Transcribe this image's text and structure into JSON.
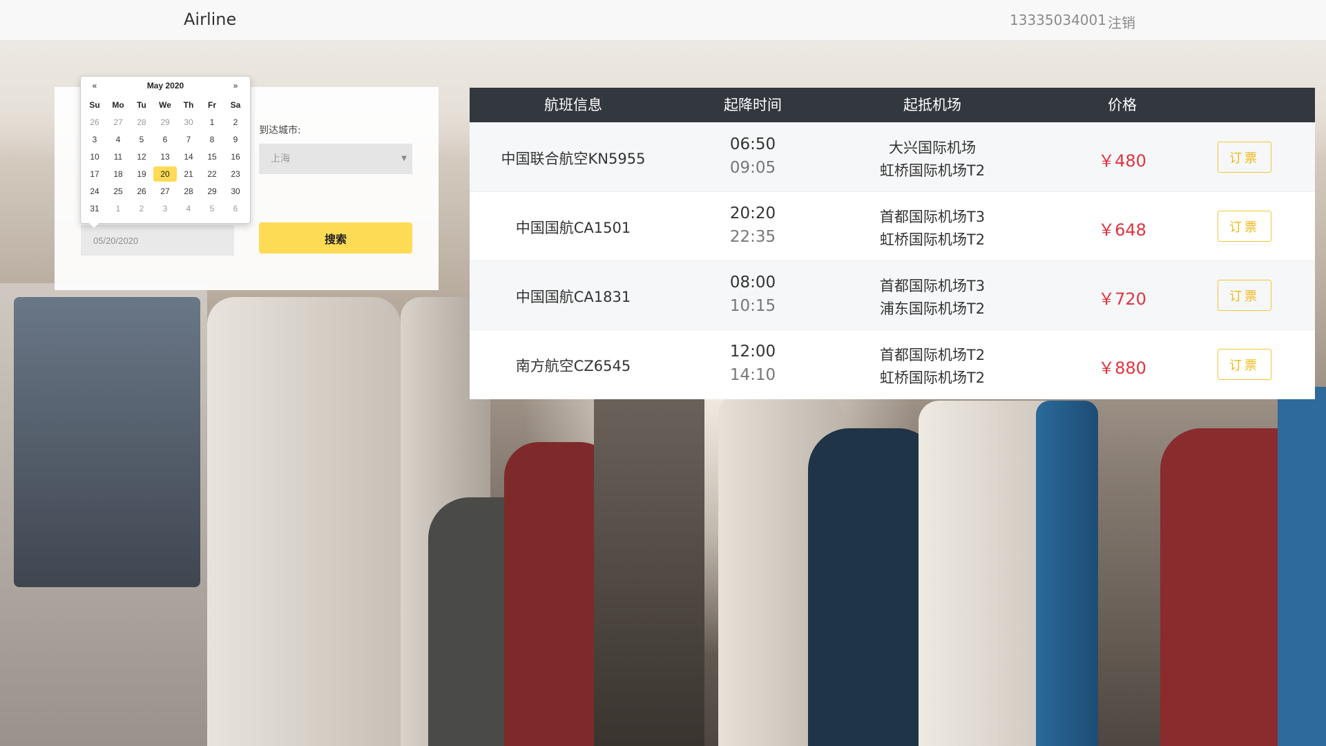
{
  "header": {
    "brand": "Airline",
    "user_phone": "13335034001",
    "logout": "注销"
  },
  "search": {
    "date_value": "05/20/2020",
    "arrive_label": "到达城市:",
    "arrive_value": "上海",
    "search_label": "搜索"
  },
  "datepicker": {
    "prev": "«",
    "next": "»",
    "title": "May 2020",
    "weekdays": [
      "Su",
      "Mo",
      "Tu",
      "We",
      "Th",
      "Fr",
      "Sa"
    ],
    "weeks": [
      [
        "26",
        "27",
        "28",
        "29",
        "30",
        "1",
        "2"
      ],
      [
        "3",
        "4",
        "5",
        "6",
        "7",
        "8",
        "9"
      ],
      [
        "10",
        "11",
        "12",
        "13",
        "14",
        "15",
        "16"
      ],
      [
        "17",
        "18",
        "19",
        "20",
        "21",
        "22",
        "23"
      ],
      [
        "24",
        "25",
        "26",
        "27",
        "28",
        "29",
        "30"
      ],
      [
        "31",
        "1",
        "2",
        "3",
        "4",
        "5",
        "6"
      ]
    ],
    "selected": "20"
  },
  "table": {
    "headers": [
      "航班信息",
      "起降时间",
      "起抵机场",
      "价格"
    ],
    "book_label": "订票",
    "rows": [
      {
        "flight": "中国联合航空KN5955",
        "depart": "06:50",
        "arrive": "09:05",
        "from_airport": "大兴国际机场",
        "to_airport": "虹桥国际机场T2",
        "price": "￥480"
      },
      {
        "flight": "中国国航CA1501",
        "depart": "20:20",
        "arrive": "22:35",
        "from_airport": "首都国际机场T3",
        "to_airport": "虹桥国际机场T2",
        "price": "￥648"
      },
      {
        "flight": "中国国航CA1831",
        "depart": "08:00",
        "arrive": "10:15",
        "from_airport": "首都国际机场T3",
        "to_airport": "浦东国际机场T2",
        "price": "￥720"
      },
      {
        "flight": "南方航空CZ6545",
        "depart": "12:00",
        "arrive": "14:10",
        "from_airport": "首都国际机场T2",
        "to_airport": "虹桥国际机场T2",
        "price": "￥880"
      }
    ]
  },
  "colors": {
    "accent": "#fedb54",
    "table_header": "#33373e",
    "price": "#e0343e",
    "book_border": "#f4c431"
  }
}
